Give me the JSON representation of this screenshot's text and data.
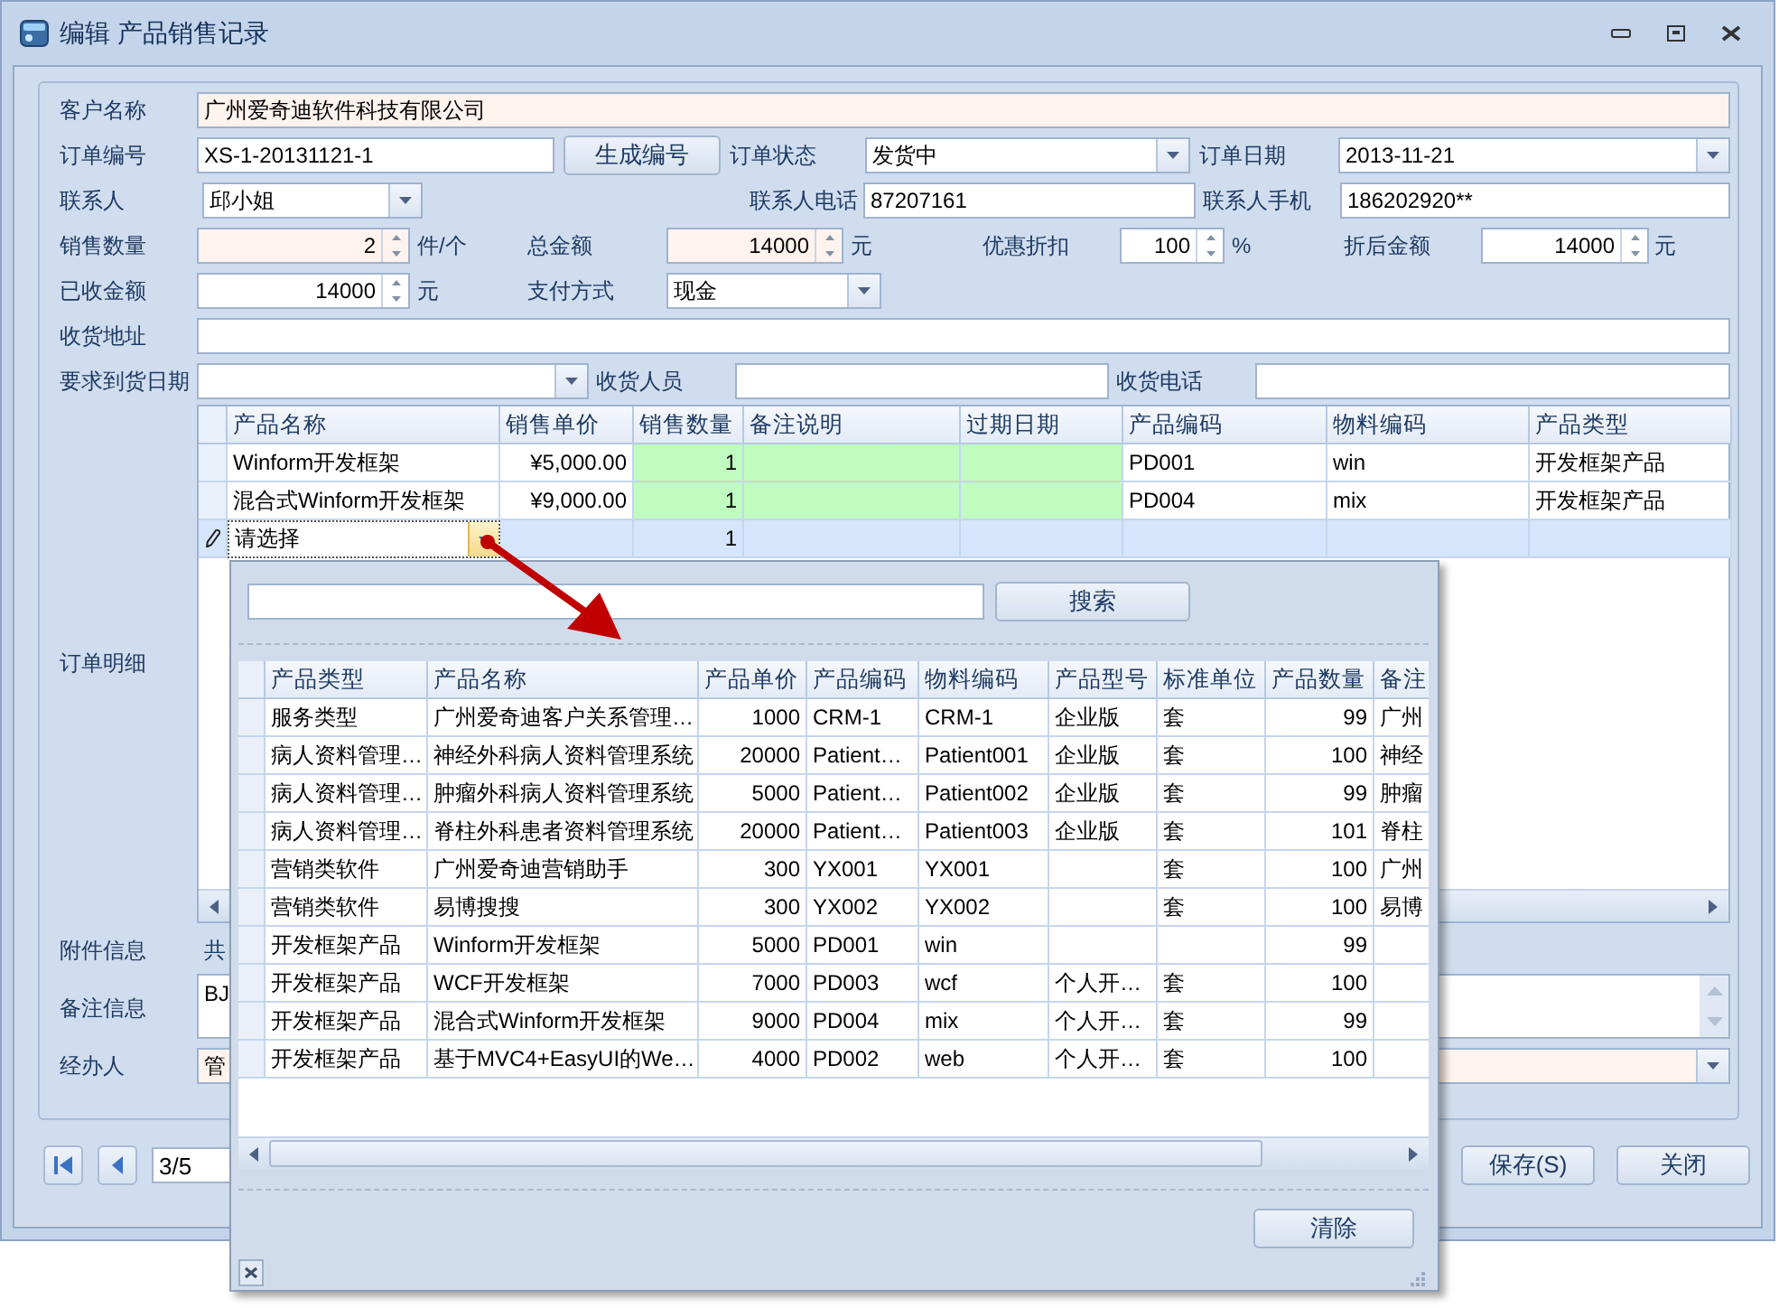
{
  "window": {
    "title": "编辑 产品销售记录"
  },
  "form": {
    "rows": [
      {
        "items": [
          {
            "kind": "label",
            "text": "客户名称"
          },
          {
            "kind": "text",
            "value": "广州爱奇迪软件科技有限公司",
            "required": true
          }
        ]
      },
      {
        "items": [
          {
            "kind": "label",
            "text": "订单编号"
          },
          {
            "kind": "text",
            "value": "XS-1-20131121-1",
            "required": false
          },
          {
            "kind": "button",
            "text": "生成编号"
          },
          {
            "kind": "label",
            "text": "订单状态"
          },
          {
            "kind": "combo",
            "value": "发货中",
            "required": false
          },
          {
            "kind": "label",
            "text": "订单日期"
          },
          {
            "kind": "combo",
            "value": "2013-11-21",
            "required": false
          }
        ]
      },
      {
        "items": [
          {
            "kind": "label",
            "text": "联系人"
          },
          {
            "kind": "combo",
            "value": "邱小姐",
            "required": false
          },
          {
            "kind": "label",
            "text": "联系人电话"
          },
          {
            "kind": "text",
            "value": "87207161",
            "required": false
          },
          {
            "kind": "label",
            "text": "联系人手机"
          },
          {
            "kind": "text",
            "value": "186202920**",
            "required": false
          }
        ]
      },
      {
        "items": [
          {
            "kind": "label",
            "text": "销售数量"
          },
          {
            "kind": "spin",
            "value": "2",
            "required": true
          },
          {
            "kind": "label",
            "text": "件/个"
          },
          {
            "kind": "label",
            "text": "总金额"
          },
          {
            "kind": "spin",
            "value": "14000",
            "required": true
          },
          {
            "kind": "label",
            "text": "元"
          },
          {
            "kind": "label",
            "text": "优惠折扣"
          },
          {
            "kind": "spin",
            "value": "100",
            "required": false
          },
          {
            "kind": "label",
            "text": "%"
          },
          {
            "kind": "label",
            "text": "折后金额"
          },
          {
            "kind": "spin",
            "value": "14000",
            "required": false
          },
          {
            "kind": "label",
            "text": "元"
          }
        ]
      },
      {
        "items": [
          {
            "kind": "label",
            "text": "已收金额"
          },
          {
            "kind": "spin",
            "value": "14000",
            "required": false
          },
          {
            "kind": "label",
            "text": "元"
          },
          {
            "kind": "label",
            "text": "支付方式"
          },
          {
            "kind": "combo",
            "value": "现金",
            "required": false
          }
        ]
      },
      {
        "items": [
          {
            "kind": "label",
            "text": "收货地址"
          },
          {
            "kind": "text",
            "required": false
          }
        ]
      },
      {
        "items": [
          {
            "kind": "label",
            "text": "要求到货日期"
          },
          {
            "kind": "combo",
            "required": false
          },
          {
            "kind": "label",
            "text": "收货人员"
          },
          {
            "kind": "text",
            "required": false
          },
          {
            "kind": "label",
            "text": "收货电话"
          },
          {
            "kind": "text",
            "required": false
          }
        ]
      }
    ]
  },
  "order_details": {
    "label": "订单明细",
    "columns": [
      {
        "title": "产品名称",
        "editable": false,
        "numeric": false
      },
      {
        "title": "销售单价",
        "editable": false,
        "numeric": true
      },
      {
        "title": "销售数量",
        "editable": true,
        "numeric": true
      },
      {
        "title": "备注说明",
        "editable": true,
        "numeric": false
      },
      {
        "title": "过期日期",
        "editable": true,
        "numeric": false
      },
      {
        "title": "产品编码",
        "editable": false,
        "numeric": false
      },
      {
        "title": "物料编码",
        "editable": false,
        "numeric": false
      },
      {
        "title": "产品类型",
        "editable": false,
        "numeric": false
      }
    ],
    "rows": [
      {
        "selected": false,
        "cells": [
          "Winform开发框架",
          "¥5,000.00",
          "1",
          null,
          null,
          "PD001",
          "win",
          "开发框架产品"
        ]
      },
      {
        "selected": false,
        "cells": [
          "混合式Winform开发框架",
          "¥9,000.00",
          "1",
          null,
          null,
          "PD004",
          "mix",
          "开发框架产品"
        ]
      },
      {
        "selected": true,
        "cells": [
          "请选择",
          null,
          "1",
          null,
          null,
          null,
          null,
          null
        ]
      }
    ]
  },
  "attachments": {
    "label": "附件信息",
    "value": "共"
  },
  "notes": {
    "label": "备注信息",
    "value": "BJ"
  },
  "handler": {
    "label": "经办人",
    "value": "管",
    "required": true
  },
  "pager": {
    "position": "3/5"
  },
  "buttons": [
    "保存(S)",
    "关闭"
  ],
  "popup": {
    "search_button": "搜索",
    "columns": [
      {
        "title": "产品类型",
        "numeric": false
      },
      {
        "title": "产品名称",
        "numeric": false
      },
      {
        "title": "产品单价",
        "numeric": true
      },
      {
        "title": "产品编码",
        "numeric": false
      },
      {
        "title": "物料编码",
        "numeric": false
      },
      {
        "title": "产品型号",
        "numeric": false
      },
      {
        "title": "标准单位",
        "numeric": false
      },
      {
        "title": "产品数量",
        "numeric": true
      },
      {
        "title": "备注",
        "numeric": false
      }
    ],
    "rows": [
      [
        "服务类型",
        "广州爱奇迪客户关系管理…",
        "1000",
        "CRM-1",
        "CRM-1",
        "企业版",
        "套",
        "99",
        "广州"
      ],
      [
        "病人资料管理…",
        "神经外科病人资料管理系统",
        "20000",
        "Patient…",
        "Patient001",
        "企业版",
        "套",
        "100",
        "神经"
      ],
      [
        "病人资料管理…",
        "肿瘤外科病人资料管理系统",
        "5000",
        "Patient…",
        "Patient002",
        "企业版",
        "套",
        "99",
        "肿瘤"
      ],
      [
        "病人资料管理…",
        "脊柱外科患者资料管理系统",
        "20000",
        "Patient…",
        "Patient003",
        "企业版",
        "套",
        "101",
        "脊柱"
      ],
      [
        "营销类软件",
        "广州爱奇迪营销助手",
        "300",
        "YX001",
        "YX001",
        null,
        "套",
        "100",
        "广州"
      ],
      [
        "营销类软件",
        "易博搜搜",
        "300",
        "YX002",
        "YX002",
        null,
        "套",
        "100",
        "易博"
      ],
      [
        "开发框架产品",
        "Winform开发框架",
        "5000",
        "PD001",
        "win",
        null,
        null,
        "99",
        null
      ],
      [
        "开发框架产品",
        "WCF开发框架",
        "7000",
        "PD003",
        "wcf",
        "个人开…",
        "套",
        "100",
        null
      ],
      [
        "开发框架产品",
        "混合式Winform开发框架",
        "9000",
        "PD004",
        "mix",
        "个人开…",
        "套",
        "99",
        null
      ],
      [
        "开发框架产品",
        "基于MVC4+EasyUI的We…",
        "4000",
        "PD002",
        "web",
        "个人开…",
        "套",
        "100",
        null
      ]
    ],
    "clear_button": "清除"
  }
}
